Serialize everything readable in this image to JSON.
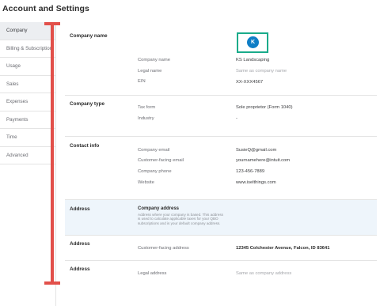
{
  "page": {
    "title": "Account and Settings"
  },
  "sidebar": {
    "items": [
      {
        "label": "Company",
        "active": true
      },
      {
        "label": "Billing & Subscription",
        "active": false
      },
      {
        "label": "Usage",
        "active": false
      },
      {
        "label": "Sales",
        "active": false
      },
      {
        "label": "Expenses",
        "active": false
      },
      {
        "label": "Payments",
        "active": false
      },
      {
        "label": "Time",
        "active": false
      },
      {
        "label": "Advanced",
        "active": false
      }
    ]
  },
  "company_name": {
    "section_label": "Company name",
    "logo_initial": "K",
    "rows": [
      {
        "label": "Company name",
        "value": "KS Landscaping"
      },
      {
        "label": "Legal name",
        "value": "Same as company name"
      },
      {
        "label": "EIN",
        "value": "XX-XXX4567"
      }
    ]
  },
  "company_type": {
    "section_label": "Company type",
    "rows": [
      {
        "label": "Tax form",
        "value": "Sole proprietor (Form 1040)"
      },
      {
        "label": "Industry",
        "value": "-"
      }
    ]
  },
  "contact_info": {
    "section_label": "Contact info",
    "rows": [
      {
        "label": "Company email",
        "value": "SusieQ@gmail.com"
      },
      {
        "label": "Customer-facing email",
        "value": "yournamehere@intuit.com"
      },
      {
        "label": "Company phone",
        "value": "123-456-7889"
      },
      {
        "label": "Website",
        "value": "www.iselthings.com"
      }
    ]
  },
  "address_highlight": {
    "section_label": "Address",
    "title": "Company address",
    "description": "Address where your company is based. This address is used to calculate applicable taxes for your QBO subscriptions and is your default company address."
  },
  "address_customer": {
    "section_label": "Address",
    "label": "Customer-facing address",
    "value": "12345 Colchester Avenue, Falcon, ID 83641"
  },
  "address_legal": {
    "section_label": "Address",
    "label": "Legal address",
    "value": "Same as company address"
  },
  "colors": {
    "annotation_bar": "#e2504a",
    "logo_border": "#1aab8a",
    "logo_fill": "#0f7ec6",
    "highlight_bg": "#eef5fb"
  }
}
